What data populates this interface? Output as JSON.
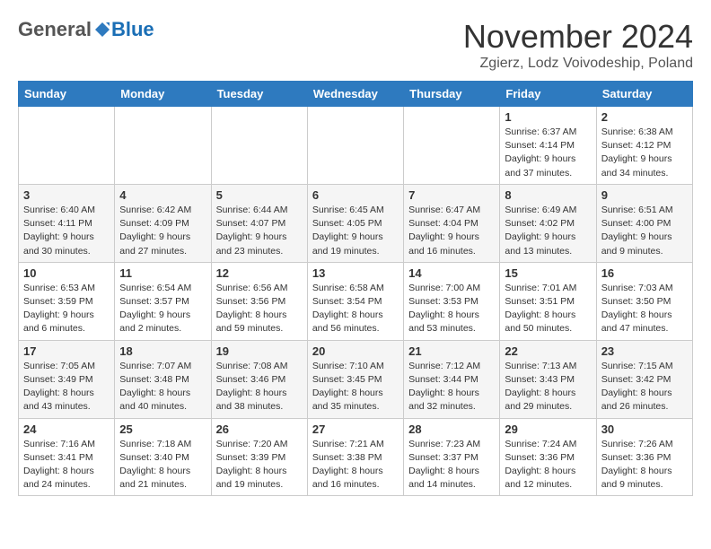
{
  "header": {
    "logo_general": "General",
    "logo_blue": "Blue",
    "month_title": "November 2024",
    "location": "Zgierz, Lodz Voivodeship, Poland"
  },
  "days_of_week": [
    "Sunday",
    "Monday",
    "Tuesday",
    "Wednesday",
    "Thursday",
    "Friday",
    "Saturday"
  ],
  "weeks": [
    [
      {
        "day": "",
        "info": ""
      },
      {
        "day": "",
        "info": ""
      },
      {
        "day": "",
        "info": ""
      },
      {
        "day": "",
        "info": ""
      },
      {
        "day": "",
        "info": ""
      },
      {
        "day": "1",
        "info": "Sunrise: 6:37 AM\nSunset: 4:14 PM\nDaylight: 9 hours\nand 37 minutes."
      },
      {
        "day": "2",
        "info": "Sunrise: 6:38 AM\nSunset: 4:12 PM\nDaylight: 9 hours\nand 34 minutes."
      }
    ],
    [
      {
        "day": "3",
        "info": "Sunrise: 6:40 AM\nSunset: 4:11 PM\nDaylight: 9 hours\nand 30 minutes."
      },
      {
        "day": "4",
        "info": "Sunrise: 6:42 AM\nSunset: 4:09 PM\nDaylight: 9 hours\nand 27 minutes."
      },
      {
        "day": "5",
        "info": "Sunrise: 6:44 AM\nSunset: 4:07 PM\nDaylight: 9 hours\nand 23 minutes."
      },
      {
        "day": "6",
        "info": "Sunrise: 6:45 AM\nSunset: 4:05 PM\nDaylight: 9 hours\nand 19 minutes."
      },
      {
        "day": "7",
        "info": "Sunrise: 6:47 AM\nSunset: 4:04 PM\nDaylight: 9 hours\nand 16 minutes."
      },
      {
        "day": "8",
        "info": "Sunrise: 6:49 AM\nSunset: 4:02 PM\nDaylight: 9 hours\nand 13 minutes."
      },
      {
        "day": "9",
        "info": "Sunrise: 6:51 AM\nSunset: 4:00 PM\nDaylight: 9 hours\nand 9 minutes."
      }
    ],
    [
      {
        "day": "10",
        "info": "Sunrise: 6:53 AM\nSunset: 3:59 PM\nDaylight: 9 hours\nand 6 minutes."
      },
      {
        "day": "11",
        "info": "Sunrise: 6:54 AM\nSunset: 3:57 PM\nDaylight: 9 hours\nand 2 minutes."
      },
      {
        "day": "12",
        "info": "Sunrise: 6:56 AM\nSunset: 3:56 PM\nDaylight: 8 hours\nand 59 minutes."
      },
      {
        "day": "13",
        "info": "Sunrise: 6:58 AM\nSunset: 3:54 PM\nDaylight: 8 hours\nand 56 minutes."
      },
      {
        "day": "14",
        "info": "Sunrise: 7:00 AM\nSunset: 3:53 PM\nDaylight: 8 hours\nand 53 minutes."
      },
      {
        "day": "15",
        "info": "Sunrise: 7:01 AM\nSunset: 3:51 PM\nDaylight: 8 hours\nand 50 minutes."
      },
      {
        "day": "16",
        "info": "Sunrise: 7:03 AM\nSunset: 3:50 PM\nDaylight: 8 hours\nand 47 minutes."
      }
    ],
    [
      {
        "day": "17",
        "info": "Sunrise: 7:05 AM\nSunset: 3:49 PM\nDaylight: 8 hours\nand 43 minutes."
      },
      {
        "day": "18",
        "info": "Sunrise: 7:07 AM\nSunset: 3:48 PM\nDaylight: 8 hours\nand 40 minutes."
      },
      {
        "day": "19",
        "info": "Sunrise: 7:08 AM\nSunset: 3:46 PM\nDaylight: 8 hours\nand 38 minutes."
      },
      {
        "day": "20",
        "info": "Sunrise: 7:10 AM\nSunset: 3:45 PM\nDaylight: 8 hours\nand 35 minutes."
      },
      {
        "day": "21",
        "info": "Sunrise: 7:12 AM\nSunset: 3:44 PM\nDaylight: 8 hours\nand 32 minutes."
      },
      {
        "day": "22",
        "info": "Sunrise: 7:13 AM\nSunset: 3:43 PM\nDaylight: 8 hours\nand 29 minutes."
      },
      {
        "day": "23",
        "info": "Sunrise: 7:15 AM\nSunset: 3:42 PM\nDaylight: 8 hours\nand 26 minutes."
      }
    ],
    [
      {
        "day": "24",
        "info": "Sunrise: 7:16 AM\nSunset: 3:41 PM\nDaylight: 8 hours\nand 24 minutes."
      },
      {
        "day": "25",
        "info": "Sunrise: 7:18 AM\nSunset: 3:40 PM\nDaylight: 8 hours\nand 21 minutes."
      },
      {
        "day": "26",
        "info": "Sunrise: 7:20 AM\nSunset: 3:39 PM\nDaylight: 8 hours\nand 19 minutes."
      },
      {
        "day": "27",
        "info": "Sunrise: 7:21 AM\nSunset: 3:38 PM\nDaylight: 8 hours\nand 16 minutes."
      },
      {
        "day": "28",
        "info": "Sunrise: 7:23 AM\nSunset: 3:37 PM\nDaylight: 8 hours\nand 14 minutes."
      },
      {
        "day": "29",
        "info": "Sunrise: 7:24 AM\nSunset: 3:36 PM\nDaylight: 8 hours\nand 12 minutes."
      },
      {
        "day": "30",
        "info": "Sunrise: 7:26 AM\nSunset: 3:36 PM\nDaylight: 8 hours\nand 9 minutes."
      }
    ]
  ]
}
